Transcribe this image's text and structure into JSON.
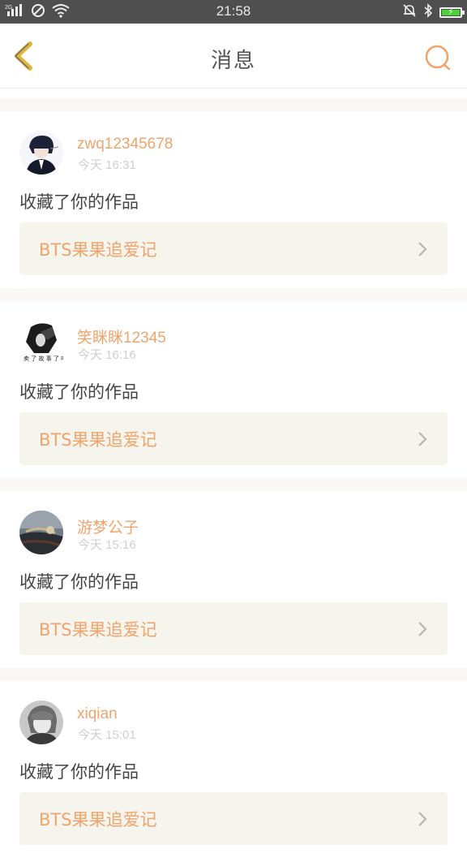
{
  "status_bar": {
    "network": "2G",
    "time": "21:58"
  },
  "header": {
    "title": "消息"
  },
  "colors": {
    "accent": "#f0a46c",
    "back_icon": "#e0b73a",
    "search_icon": "#f0a46c",
    "card_link_bg": "#f5f5ee"
  },
  "messages": [
    {
      "username": "zwq12345678",
      "time": "今天  16:31",
      "action": "收藏了你的作品",
      "work_title": "BTS果果追爱记"
    },
    {
      "username": "笑眯眯12345",
      "time": "今天  16:16",
      "action": "收藏了你的作品",
      "work_title": "BTS果果追爱记"
    },
    {
      "username": "游梦公子",
      "time": "今天  15:16",
      "action": "收藏了你的作品",
      "work_title": "BTS果果追爱记"
    },
    {
      "username": "xiqian",
      "time": "今天  15:01",
      "action": "收藏了你的作品",
      "work_title": "BTS果果追爱记"
    }
  ]
}
